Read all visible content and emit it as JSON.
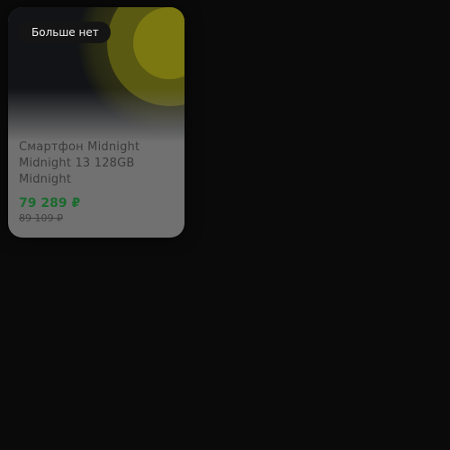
{
  "product_card": {
    "badge_label": "Больше нет",
    "title": "Смартфон Midnight Midnight 13 128GB Midnight",
    "price": "79 289 ₽",
    "old_price": "89 109 ₽",
    "image_icon": "product-photo-placeholder",
    "colors": {
      "page_background": "#0a0a0a",
      "card_background": "#717171",
      "price": "#1b6a2e",
      "image_accent": "#7b7812"
    }
  }
}
